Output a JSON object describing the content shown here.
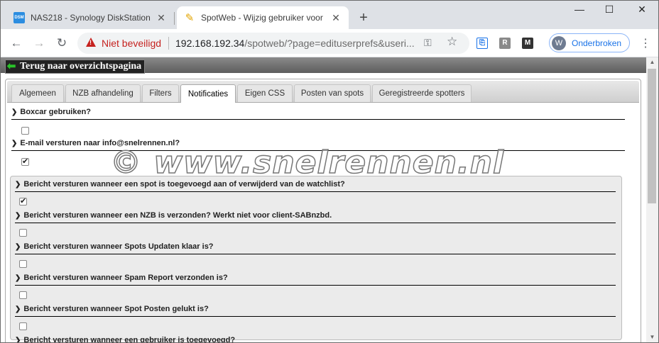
{
  "browser": {
    "tabs": [
      {
        "title": "NAS218 - Synology DiskStation",
        "favicon": "dsm-icon",
        "favicon_text": "DSM"
      },
      {
        "title": "SpotWeb - Wijzig gebruiker voor",
        "favicon": "pen-icon"
      }
    ],
    "security_label": "Niet beveiligd",
    "url_host": "192.168.192.34",
    "url_rest": "/spotweb/?page=edituserprefs&useri...",
    "profile": {
      "initial": "W",
      "label": "Onderbroken"
    },
    "extensions": [
      {
        "name": "dashlane-icon",
        "text": "⎘",
        "color": "#1a73e8"
      },
      {
        "name": "readability-icon",
        "text": "R",
        "color": "#8a8a8a"
      },
      {
        "name": "gmail-icon",
        "text": "M",
        "color": "#333333"
      }
    ]
  },
  "page": {
    "back_label": "Terug naar overzichtspagina",
    "tabs": [
      "Algemeen",
      "NZB afhandeling",
      "Filters",
      "Notificaties",
      "Eigen CSS",
      "Posten van spots",
      "Geregistreerde spotters"
    ],
    "active_tab": "Notificaties",
    "prefs": [
      {
        "label": "Boxcar gebruiken?",
        "checked": false
      },
      {
        "label": "E-mail versturen naar info@snelrennen.nl?",
        "checked": true
      }
    ],
    "notifications": [
      {
        "label": "Bericht versturen wanneer een spot is toegevoegd aan of verwijderd van de watchlist?",
        "checked": true
      },
      {
        "label": "Bericht versturen wanneer een NZB is verzonden? Werkt niet voor client-SABnzbd.",
        "checked": false
      },
      {
        "label": "Bericht versturen wanneer Spots Updaten klaar is?",
        "checked": false
      },
      {
        "label": "Bericht versturen wanneer Spam Report verzonden is?",
        "checked": false
      },
      {
        "label": "Bericht versturen wanneer Spot Posten gelukt is?",
        "checked": false
      },
      {
        "label": "Bericht versturen wanneer een gebruiker is toegevoegd?",
        "checked": false
      }
    ],
    "watermark": "© www.snelrennen.nl"
  }
}
